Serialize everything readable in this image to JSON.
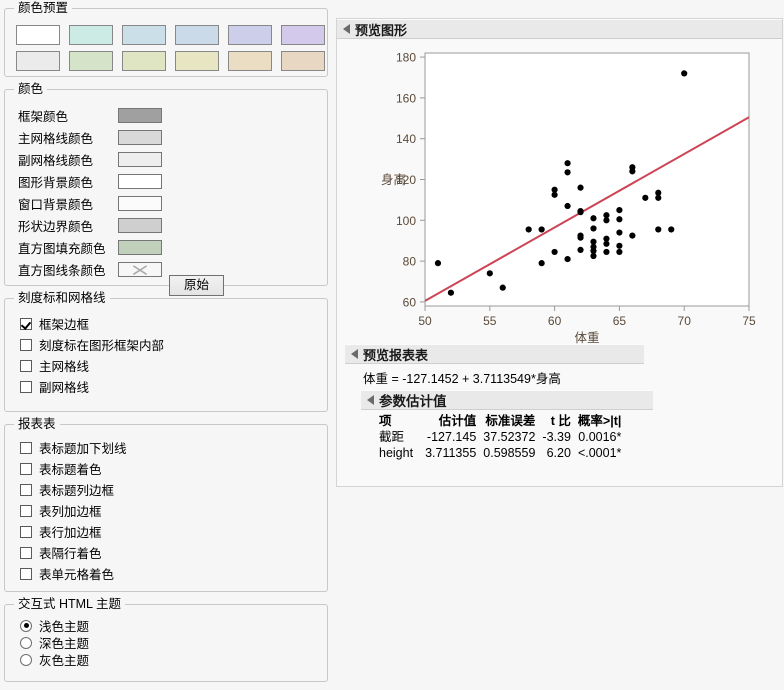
{
  "colors": {
    "window_bg": "#f6f6f6",
    "panel_bg": "#f9f9f9",
    "group_border": "#c8c8c8",
    "outline_header_bg": "#e9e9e9",
    "fit_line": "#cc4455",
    "point": "#000000",
    "axis_text": "#5b4a3a"
  },
  "presets_group": {
    "title": "颜色预置",
    "rows": [
      [
        {
          "name": "preset-white",
          "color": "#ffffff"
        },
        {
          "name": "preset-mint",
          "color": "#ccebe5"
        },
        {
          "name": "preset-lightblue",
          "color": "#cbdfe8"
        },
        {
          "name": "preset-steelblue",
          "color": "#cadae9"
        },
        {
          "name": "preset-periwinkle",
          "color": "#ccceea"
        },
        {
          "name": "preset-lavender",
          "color": "#d3c9ea"
        }
      ],
      [
        {
          "name": "preset-lightgray",
          "color": "#ebebeb"
        },
        {
          "name": "preset-sage",
          "color": "#d5e4c8"
        },
        {
          "name": "preset-olive",
          "color": "#dfe4c2"
        },
        {
          "name": "preset-khaki",
          "color": "#e8e6c2"
        },
        {
          "name": "preset-sand",
          "color": "#ebddc4"
        },
        {
          "name": "preset-tan",
          "color": "#e8d7c3"
        }
      ]
    ]
  },
  "colors_group": {
    "title": "颜色",
    "reset_button": "原始",
    "rows": [
      {
        "label": "框架颜色",
        "name": "frame-color",
        "color": "#a0a0a0",
        "x_mark": false
      },
      {
        "label": "主网格线颜色",
        "name": "major-grid-color",
        "color": "#d9d9d9",
        "x_mark": false
      },
      {
        "label": "副网格线颜色",
        "name": "minor-grid-color",
        "color": "#eeeeee",
        "x_mark": false
      },
      {
        "label": "图形背景颜色",
        "name": "graph-background-color",
        "color": "#ffffff",
        "x_mark": false
      },
      {
        "label": "窗口背景颜色",
        "name": "window-background-color",
        "color": "#fbfbfb",
        "x_mark": false
      },
      {
        "label": "形状边界颜色",
        "name": "shape-boundary-color",
        "color": "#cfcfcf",
        "x_mark": false
      },
      {
        "label": "直方图填充颜色",
        "name": "histogram-fill-color",
        "color": "#c0d0bb",
        "x_mark": false
      },
      {
        "label": "直方图线条颜色",
        "name": "histogram-line-color",
        "color": "#f7f7f7",
        "x_mark": true
      }
    ]
  },
  "ticks_group": {
    "title": "刻度标和网格线",
    "items": [
      {
        "label": "框架边框",
        "name": "frame-border",
        "checked": true
      },
      {
        "label": "刻度标在图形框架内部",
        "name": "ticks-inside-frame",
        "checked": false
      },
      {
        "label": "主网格线",
        "name": "major-gridlines",
        "checked": false
      },
      {
        "label": "副网格线",
        "name": "minor-gridlines",
        "checked": false
      }
    ]
  },
  "report_group": {
    "title": "报表表",
    "items": [
      {
        "label": "表标题加下划线",
        "name": "table-title-underline",
        "checked": false
      },
      {
        "label": "表标题着色",
        "name": "table-title-color",
        "checked": false
      },
      {
        "label": "表标题列边框",
        "name": "table-title-col-border",
        "checked": false
      },
      {
        "label": "表列加边框",
        "name": "table-col-border",
        "checked": false
      },
      {
        "label": "表行加边框",
        "name": "table-row-border",
        "checked": false
      },
      {
        "label": "表隔行着色",
        "name": "table-alt-row-color",
        "checked": false
      },
      {
        "label": "表单元格着色",
        "name": "table-cell-color",
        "checked": false
      }
    ]
  },
  "theme_group": {
    "title": "交互式 HTML 主题",
    "items": [
      {
        "label": "浅色主题",
        "name": "theme-light",
        "checked": true
      },
      {
        "label": "深色主题",
        "name": "theme-dark",
        "checked": false
      },
      {
        "label": "灰色主题",
        "name": "theme-gray",
        "checked": false
      }
    ]
  },
  "preview": {
    "graph_outline_title": "预览图形",
    "report_outline_title": "预览报表表",
    "equation": "体重 = -127.1452 + 3.7113549*身高",
    "estimates_outline_title": "参数估计值",
    "estimates": {
      "headers": [
        "项",
        "估计值",
        "标准误差",
        "t 比",
        "概率>|t|"
      ],
      "rows": [
        [
          "截距",
          "-127.145",
          "37.52372",
          "-3.39",
          "0.0016*"
        ],
        [
          "height",
          "3.711355",
          "0.598559",
          "6.20",
          "<.0001*"
        ]
      ]
    }
  },
  "chart_data": {
    "type": "scatter",
    "title": "",
    "xlabel": "体重",
    "ylabel": "身高",
    "xlim": [
      50,
      75
    ],
    "ylim": [
      58,
      182
    ],
    "xticks": [
      50,
      55,
      60,
      65,
      70,
      75
    ],
    "yticks": [
      60,
      80,
      100,
      120,
      140,
      160,
      180
    ],
    "grid": false,
    "legend": "none",
    "point_color": "#000000",
    "points": [
      [
        51,
        79
      ],
      [
        52,
        64.5
      ],
      [
        55,
        74
      ],
      [
        56,
        67
      ],
      [
        58,
        95.5
      ],
      [
        59,
        95.5
      ],
      [
        59,
        79
      ],
      [
        60,
        115
      ],
      [
        60,
        112.5
      ],
      [
        60,
        84.5
      ],
      [
        61,
        128
      ],
      [
        61,
        123.5
      ],
      [
        61,
        107
      ],
      [
        61,
        81
      ],
      [
        62,
        116
      ],
      [
        62,
        104
      ],
      [
        62,
        91.5
      ],
      [
        62,
        92.5
      ],
      [
        62,
        85.5
      ],
      [
        62,
        104.5
      ],
      [
        63,
        96
      ],
      [
        63,
        101
      ],
      [
        63,
        87
      ],
      [
        63,
        89.5
      ],
      [
        63,
        85
      ],
      [
        63,
        82.5
      ],
      [
        64,
        102.5
      ],
      [
        64,
        100
      ],
      [
        64,
        88.5
      ],
      [
        64,
        91
      ],
      [
        64,
        84.5
      ],
      [
        65,
        105
      ],
      [
        65,
        100.5
      ],
      [
        65,
        94
      ],
      [
        65,
        87.5
      ],
      [
        65,
        84.5
      ],
      [
        66,
        124
      ],
      [
        66,
        126
      ],
      [
        66,
        92.5
      ],
      [
        67,
        111
      ],
      [
        68,
        113.5
      ],
      [
        68,
        111
      ],
      [
        68,
        95.5
      ],
      [
        69,
        95.5
      ],
      [
        70,
        172
      ]
    ],
    "fit_line": {
      "color": "#cc4455",
      "x": [
        50,
        75
      ],
      "y": [
        60.5,
        150.5
      ],
      "label": "体重 = -127.1452 + 3.7113549*身高"
    }
  }
}
